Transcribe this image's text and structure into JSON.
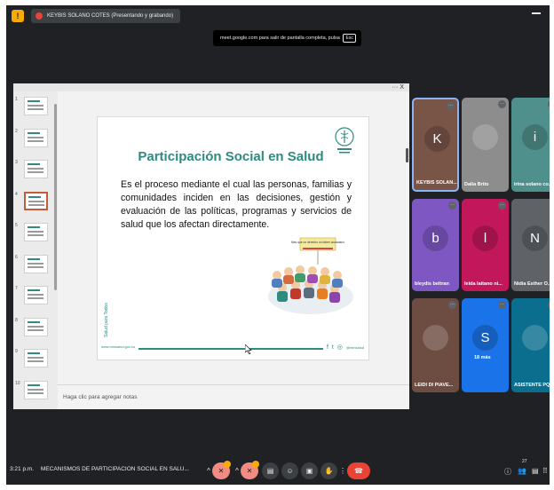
{
  "presenter": {
    "label": "KEYBIS SOLANO COTES (Presentando y grabando)"
  },
  "fullscreen_toast": {
    "text": "meet.google.com para salir de pantalla completa, pulsa",
    "key": "Esc"
  },
  "window": {
    "controls": "···  X"
  },
  "thumbnails": {
    "numbers": [
      "1",
      "2",
      "3",
      "4",
      "5",
      "6",
      "7",
      "8",
      "9",
      "10"
    ],
    "active_index": 4
  },
  "slide": {
    "title": "Participación Social en Salud",
    "body": "Es el proceso mediante el cual las personas, familias y comunidades inciden en las decisiones, gestión y evaluación de las políticas, programas y servicios de salud que los afectan directamente.",
    "banner": "Mas que un derecho un deber ciudadano",
    "vertical_logo": "Salud para Todos",
    "footer_left": "www.minsalud.gov.co",
    "footer_icons": "f t ◎",
    "footer_right": "@minsalud"
  },
  "notes": {
    "placeholder": "Haga clic para agregar notas"
  },
  "participants": [
    {
      "name": "KEYBIS SOLAN...",
      "initial": "K",
      "color": "#795548"
    },
    {
      "name": "Dalia Brito",
      "initial": "",
      "color": "#8d8d8d"
    },
    {
      "name": "irina solano co...",
      "initial": "i",
      "color": "#4f8f8c"
    },
    {
      "name": "bleydis beltran",
      "initial": "b",
      "color": "#7e57c2"
    },
    {
      "name": "leida laitano ni...",
      "initial": "l",
      "color": "#c2185b"
    },
    {
      "name": "Nidia Esther O...",
      "initial": "N",
      "color": "#5f6368"
    },
    {
      "name": "LEIDI DI PIAVE...",
      "initial": "",
      "color": "#6d4c41"
    },
    {
      "name": "18 más",
      "initial": "S",
      "color": "#1a73e8"
    },
    {
      "name": "ASISTENTE PQR",
      "initial": "",
      "color": "#0b6e8f"
    }
  ],
  "meeting": {
    "time": "3:21 p.m.",
    "title": "MECANISMOS DE PARTICIPACION SOCIAL EN SALU..."
  },
  "controls": {
    "participant_count": "27"
  }
}
